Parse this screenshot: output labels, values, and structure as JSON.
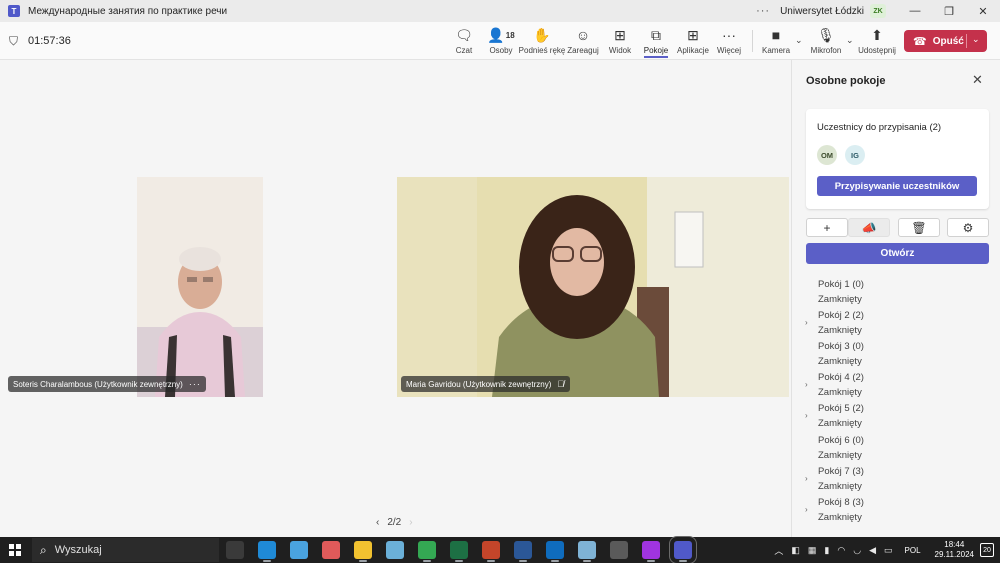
{
  "window": {
    "title": "Международные занятия по практике речи",
    "organization": "Uniwersytet Łódzki",
    "org_badge": "ZK"
  },
  "meeting": {
    "timer": "01:57:36",
    "toolbar": [
      {
        "id": "chat",
        "label": "Czat",
        "icon": "chat-icon"
      },
      {
        "id": "people",
        "label": "Osoby",
        "icon": "people-icon",
        "count": "18"
      },
      {
        "id": "raise-hand",
        "label": "Podnieś rękę",
        "icon": "hand-icon"
      },
      {
        "id": "react",
        "label": "Zareaguj",
        "icon": "smile-icon"
      },
      {
        "id": "view",
        "label": "Widok",
        "icon": "grid-icon"
      },
      {
        "id": "rooms",
        "label": "Pokoje",
        "icon": "rooms-icon",
        "active": true
      },
      {
        "id": "apps",
        "label": "Aplikacje",
        "icon": "plus-icon"
      },
      {
        "id": "more",
        "label": "Więcej",
        "icon": "more-icon"
      },
      {
        "id": "camera",
        "label": "Kamera",
        "icon": "camera-icon"
      },
      {
        "id": "mic",
        "label": "Mikrofon",
        "icon": "mic-icon"
      },
      {
        "id": "share",
        "label": "Udostępnij",
        "icon": "share-icon"
      }
    ],
    "leave_label": "Opuść"
  },
  "participants": [
    {
      "name": "Soteris Charalambous (Użytkownik zewnętrzny)",
      "extra": "···"
    },
    {
      "name": "Maria Gavridou (Użytkownik zewnętrzny)",
      "extra": "mic-muted-icon"
    }
  ],
  "pager": {
    "text": "2/2"
  },
  "breakout_panel": {
    "title": "Osobne pokoje",
    "assign_heading": "Uczestnicy do przypisania (2)",
    "avatars": [
      "OM",
      "IG"
    ],
    "assign_button": "Przypisywanie uczestników",
    "actions": [
      "add-room-icon",
      "announce-icon",
      "delete-icon",
      "settings-icon"
    ],
    "open_button": "Otwórz",
    "rooms": [
      {
        "name": "Pokój 1",
        "count": "(0)",
        "status": "Zamknięty",
        "expandable": false
      },
      {
        "name": "Pokój 2",
        "count": "(2)",
        "status": "Zamknięty",
        "expandable": true
      },
      {
        "name": "Pokój 3",
        "count": "(0)",
        "status": "Zamknięty",
        "expandable": false
      },
      {
        "name": "Pokój 4",
        "count": "(2)",
        "status": "Zamknięty",
        "expandable": true
      },
      {
        "name": "Pokój 5",
        "count": "(2)",
        "status": "Zamknięty",
        "expandable": true
      },
      {
        "name": "Pokój 6",
        "count": "(0)",
        "status": "Zamknięty",
        "expandable": false
      },
      {
        "name": "Pokój 7",
        "count": "(3)",
        "status": "Zamknięty",
        "expandable": true
      },
      {
        "name": "Pokój 8",
        "count": "(3)",
        "status": "Zamknięty",
        "expandable": true
      }
    ]
  },
  "taskbar": {
    "search_placeholder": "Wyszukaj",
    "apps": [
      {
        "name": "task-view",
        "color": "#3a3a3a"
      },
      {
        "name": "edge",
        "color": "#1f8ad6"
      },
      {
        "name": "photos",
        "color": "#4aa3df"
      },
      {
        "name": "paint",
        "color": "#e05a5a"
      },
      {
        "name": "file-explorer",
        "color": "#f2c230"
      },
      {
        "name": "snip",
        "color": "#6bb0d8"
      },
      {
        "name": "chrome",
        "color": "#34a853"
      },
      {
        "name": "excel",
        "color": "#1d7044"
      },
      {
        "name": "powerpoint",
        "color": "#c4452a"
      },
      {
        "name": "word",
        "color": "#2b5797"
      },
      {
        "name": "outlook",
        "color": "#0f6cbd"
      },
      {
        "name": "notes",
        "color": "#7fb3d5"
      },
      {
        "name": "calculator",
        "color": "#5a5a5a"
      },
      {
        "name": "messenger",
        "color": "#a034e0"
      },
      {
        "name": "teams",
        "color": "#5059c9"
      }
    ],
    "language": "POL",
    "time": "18:44",
    "date": "29.11.2024",
    "notifications": "20"
  }
}
